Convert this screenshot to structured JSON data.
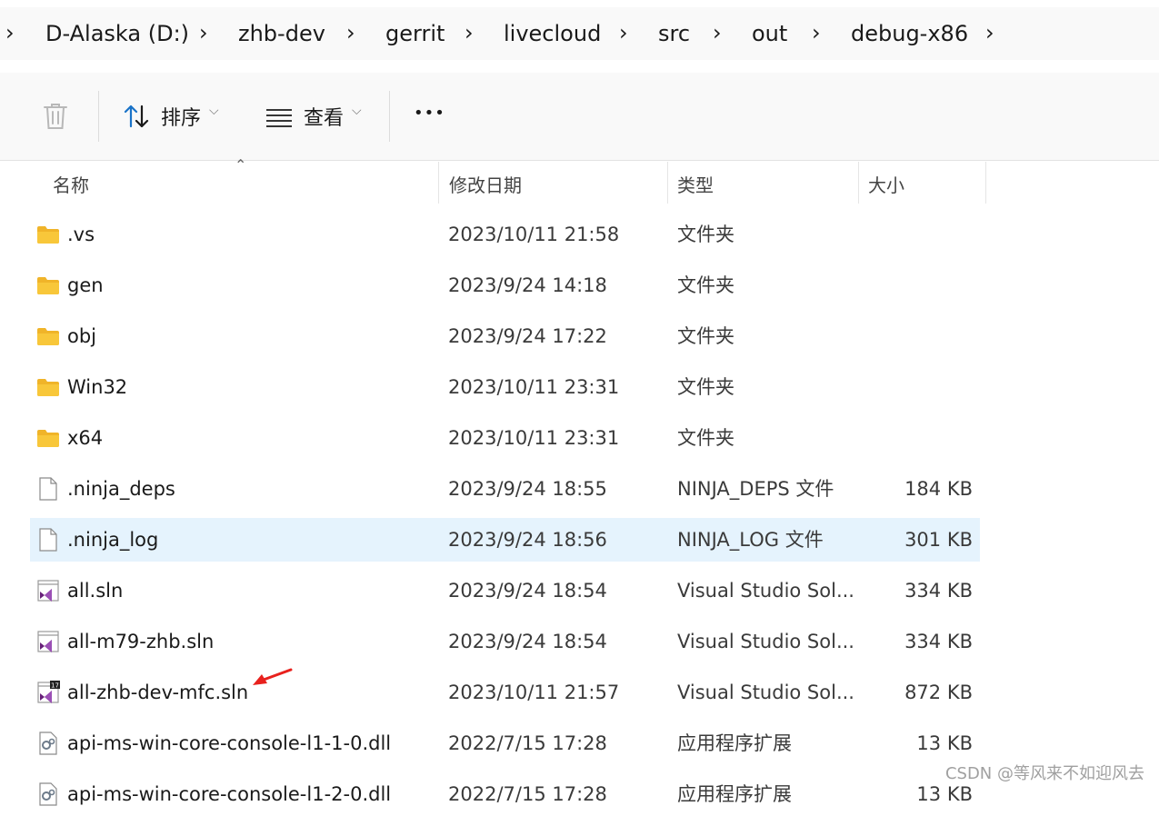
{
  "breadcrumb": [
    "D-Alaska (D:)",
    "zhb-dev",
    "gerrit",
    "livecloud",
    "src",
    "out",
    "debug-x86"
  ],
  "toolbar": {
    "sort_label": "排序",
    "view_label": "查看",
    "more_label": "•••"
  },
  "columns": {
    "name": "名称",
    "date": "修改日期",
    "type": "类型",
    "size": "大小"
  },
  "files": [
    {
      "name": ".vs",
      "date": "2023/10/11 21:58",
      "type": "文件夹",
      "size": "",
      "icon": "folder-icon"
    },
    {
      "name": "gen",
      "date": "2023/9/24 14:18",
      "type": "文件夹",
      "size": "",
      "icon": "folder-icon"
    },
    {
      "name": "obj",
      "date": "2023/9/24 17:22",
      "type": "文件夹",
      "size": "",
      "icon": "folder-icon"
    },
    {
      "name": "Win32",
      "date": "2023/10/11 23:31",
      "type": "文件夹",
      "size": "",
      "icon": "folder-icon"
    },
    {
      "name": "x64",
      "date": "2023/10/11 23:31",
      "type": "文件夹",
      "size": "",
      "icon": "folder-icon"
    },
    {
      "name": ".ninja_deps",
      "date": "2023/9/24 18:55",
      "type": "NINJA_DEPS 文件",
      "size": "184 KB",
      "icon": "file-icon"
    },
    {
      "name": ".ninja_log",
      "date": "2023/9/24 18:56",
      "type": "NINJA_LOG 文件",
      "size": "301 KB",
      "icon": "file-icon"
    },
    {
      "name": "all.sln",
      "date": "2023/9/24 18:54",
      "type": "Visual Studio Sol...",
      "size": "334 KB",
      "icon": "visual-studio-solution-icon"
    },
    {
      "name": "all-m79-zhb.sln",
      "date": "2023/9/24 18:54",
      "type": "Visual Studio Sol...",
      "size": "334 KB",
      "icon": "visual-studio-solution-icon"
    },
    {
      "name": "all-zhb-dev-mfc.sln",
      "date": "2023/10/11 21:57",
      "type": "Visual Studio Sol...",
      "size": "872 KB",
      "icon": "visual-studio-2022-solution-icon",
      "badge": "17"
    },
    {
      "name": "api-ms-win-core-console-l1-1-0.dll",
      "date": "2022/7/15 17:28",
      "type": "应用程序扩展",
      "size": "13 KB",
      "icon": "dll-icon"
    },
    {
      "name": "api-ms-win-core-console-l1-2-0.dll",
      "date": "2022/7/15 17:28",
      "type": "应用程序扩展",
      "size": "13 KB",
      "icon": "dll-icon"
    }
  ],
  "selected_row": 6,
  "annotation": "red-arrow-icon",
  "watermark": "CSDN @等风来不如迎风去",
  "colors": {
    "selection": "#e5f3fd",
    "folder": "#f8c73a",
    "vs_purple": "#68217a",
    "arrow": "#e8211d"
  }
}
